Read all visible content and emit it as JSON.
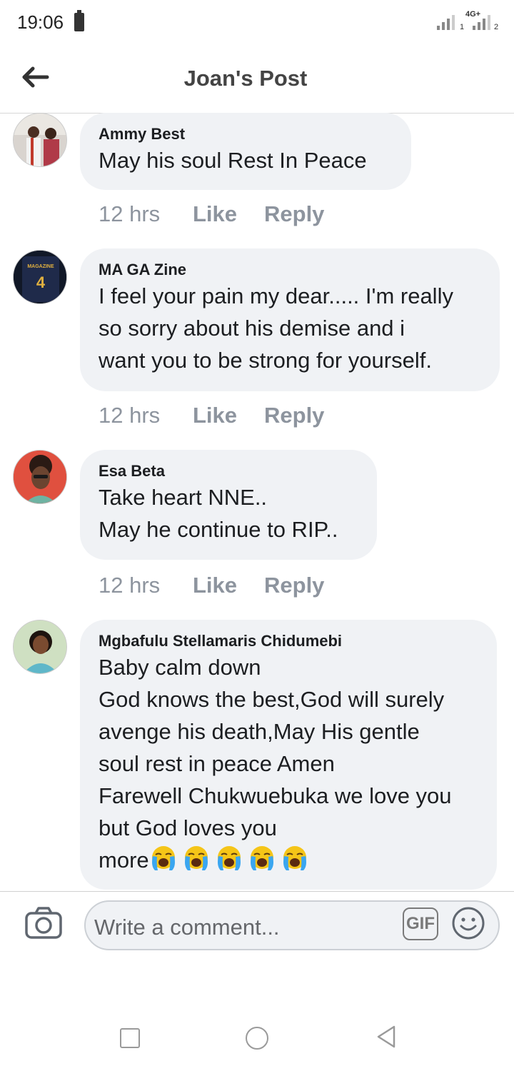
{
  "status_bar": {
    "time": "19:06",
    "network": "4G+",
    "sim1": "1",
    "sim2": "2"
  },
  "header": {
    "title": "Joan's Post"
  },
  "comments": [
    {
      "author": "Ammy Best",
      "text": "May his soul Rest In Peace",
      "time": "12 hrs",
      "like": "Like",
      "reply": "Reply"
    },
    {
      "author": "MA GA Zine",
      "text": "I feel your pain my dear..... I'm really\nso sorry about his demise and i\nwant you to be strong for yourself.",
      "time": "12 hrs",
      "like": "Like",
      "reply": "Reply",
      "avatar_text": "MAGAZINE",
      "avatar_number": "4"
    },
    {
      "author": "Esa Beta",
      "text": "Take heart NNE..\nMay he continue to RIP..",
      "time": "12 hrs",
      "like": "Like",
      "reply": "Reply"
    },
    {
      "author": "Mgbafulu Stellamaris Chidumebi",
      "text": "Baby calm down\nGod knows the best,God will surely\navenge his death,May His gentle\nsoul rest in peace Amen\nFarewell Chukwuebuka we love you\nbut God loves you\nmore",
      "emojis": [
        "loudly-crying-face",
        "loudly-crying-face",
        "loudly-crying-face",
        "loudly-crying-face",
        "loudly-crying-face"
      ]
    }
  ],
  "composer": {
    "placeholder": "Write a comment...",
    "gif_label": "GIF"
  },
  "icons": {
    "back": "arrow-left-icon",
    "camera": "camera-icon",
    "emoji": "smiley-icon",
    "nav_recents": "square-icon",
    "nav_home": "circle-icon",
    "nav_back": "triangle-back-icon"
  },
  "colors": {
    "bubble": "#f0f2f5",
    "meta_text": "#8d949e",
    "emoji_face": "#f5c518",
    "tear": "#3aa6f0"
  }
}
